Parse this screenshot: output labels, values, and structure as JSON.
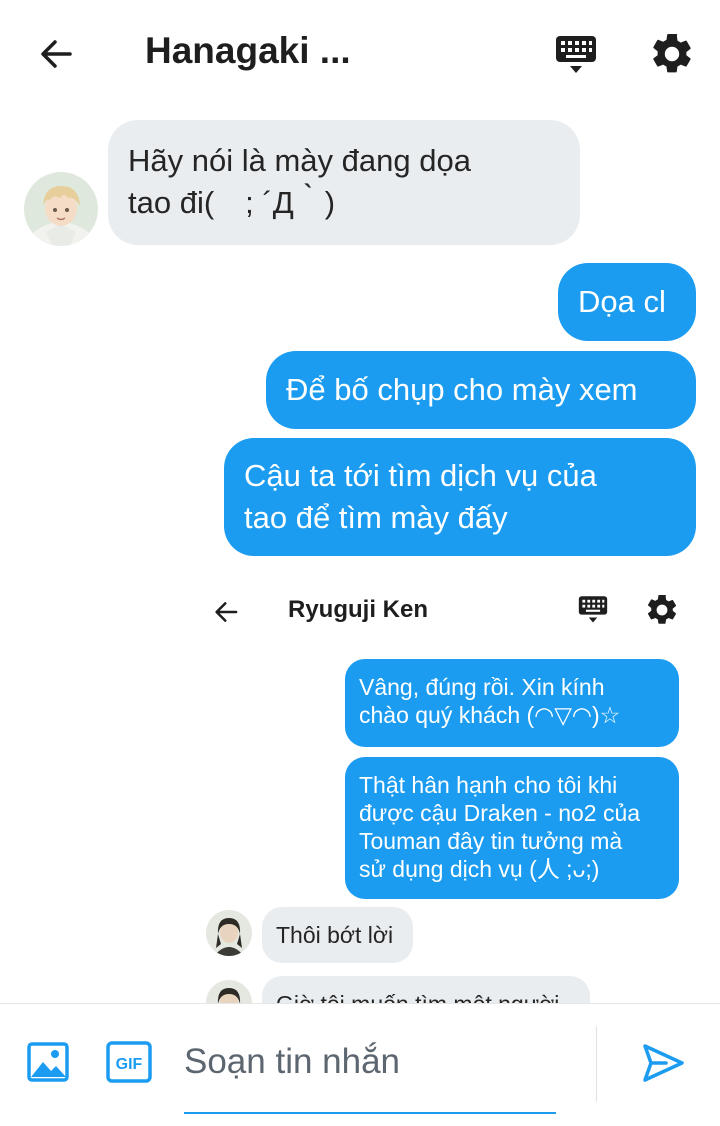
{
  "header": {
    "title": "Hanagaki ..."
  },
  "messages": [
    {
      "side": "in",
      "text_line1": "Hãy nói là mày đang dọa",
      "text_line2": "tao đi(　; ´Д｀)"
    },
    {
      "side": "out",
      "text": "Dọa cl"
    },
    {
      "side": "out",
      "text": "Để bố chụp cho mày xem"
    },
    {
      "side": "out",
      "text_line1": "Cậu ta tới tìm dịch vụ của",
      "text_line2": "tao để tìm mày đấy"
    }
  ],
  "embedded": {
    "title": "Ryuguji Ken",
    "messages": [
      {
        "side": "out",
        "line1": "Vâng, đúng rồi. Xin kính",
        "line2": "chào quý khách (◠▽◠)☆"
      },
      {
        "side": "out",
        "line1": "Thật hân hạnh cho tôi khi",
        "line2": "được cậu Draken - no2 của",
        "line3": "Touman đây tin tưởng mà",
        "line4": "sử dụng dịch vụ (人 ;ᴗ;)"
      },
      {
        "side": "in",
        "text": "Thôi bớt lời"
      },
      {
        "side": "in",
        "text": "Giờ tôi muốn tìm một người"
      }
    ]
  },
  "composer": {
    "placeholder": "Soạn tin nhắn",
    "gif_label": "GIF"
  },
  "colors": {
    "accent": "#1b9cf0",
    "incoming_bubble": "#e9edf0"
  },
  "icons": [
    "back-arrow-icon",
    "keyboard-icon",
    "gear-icon",
    "image-icon",
    "gif-icon",
    "send-icon"
  ]
}
